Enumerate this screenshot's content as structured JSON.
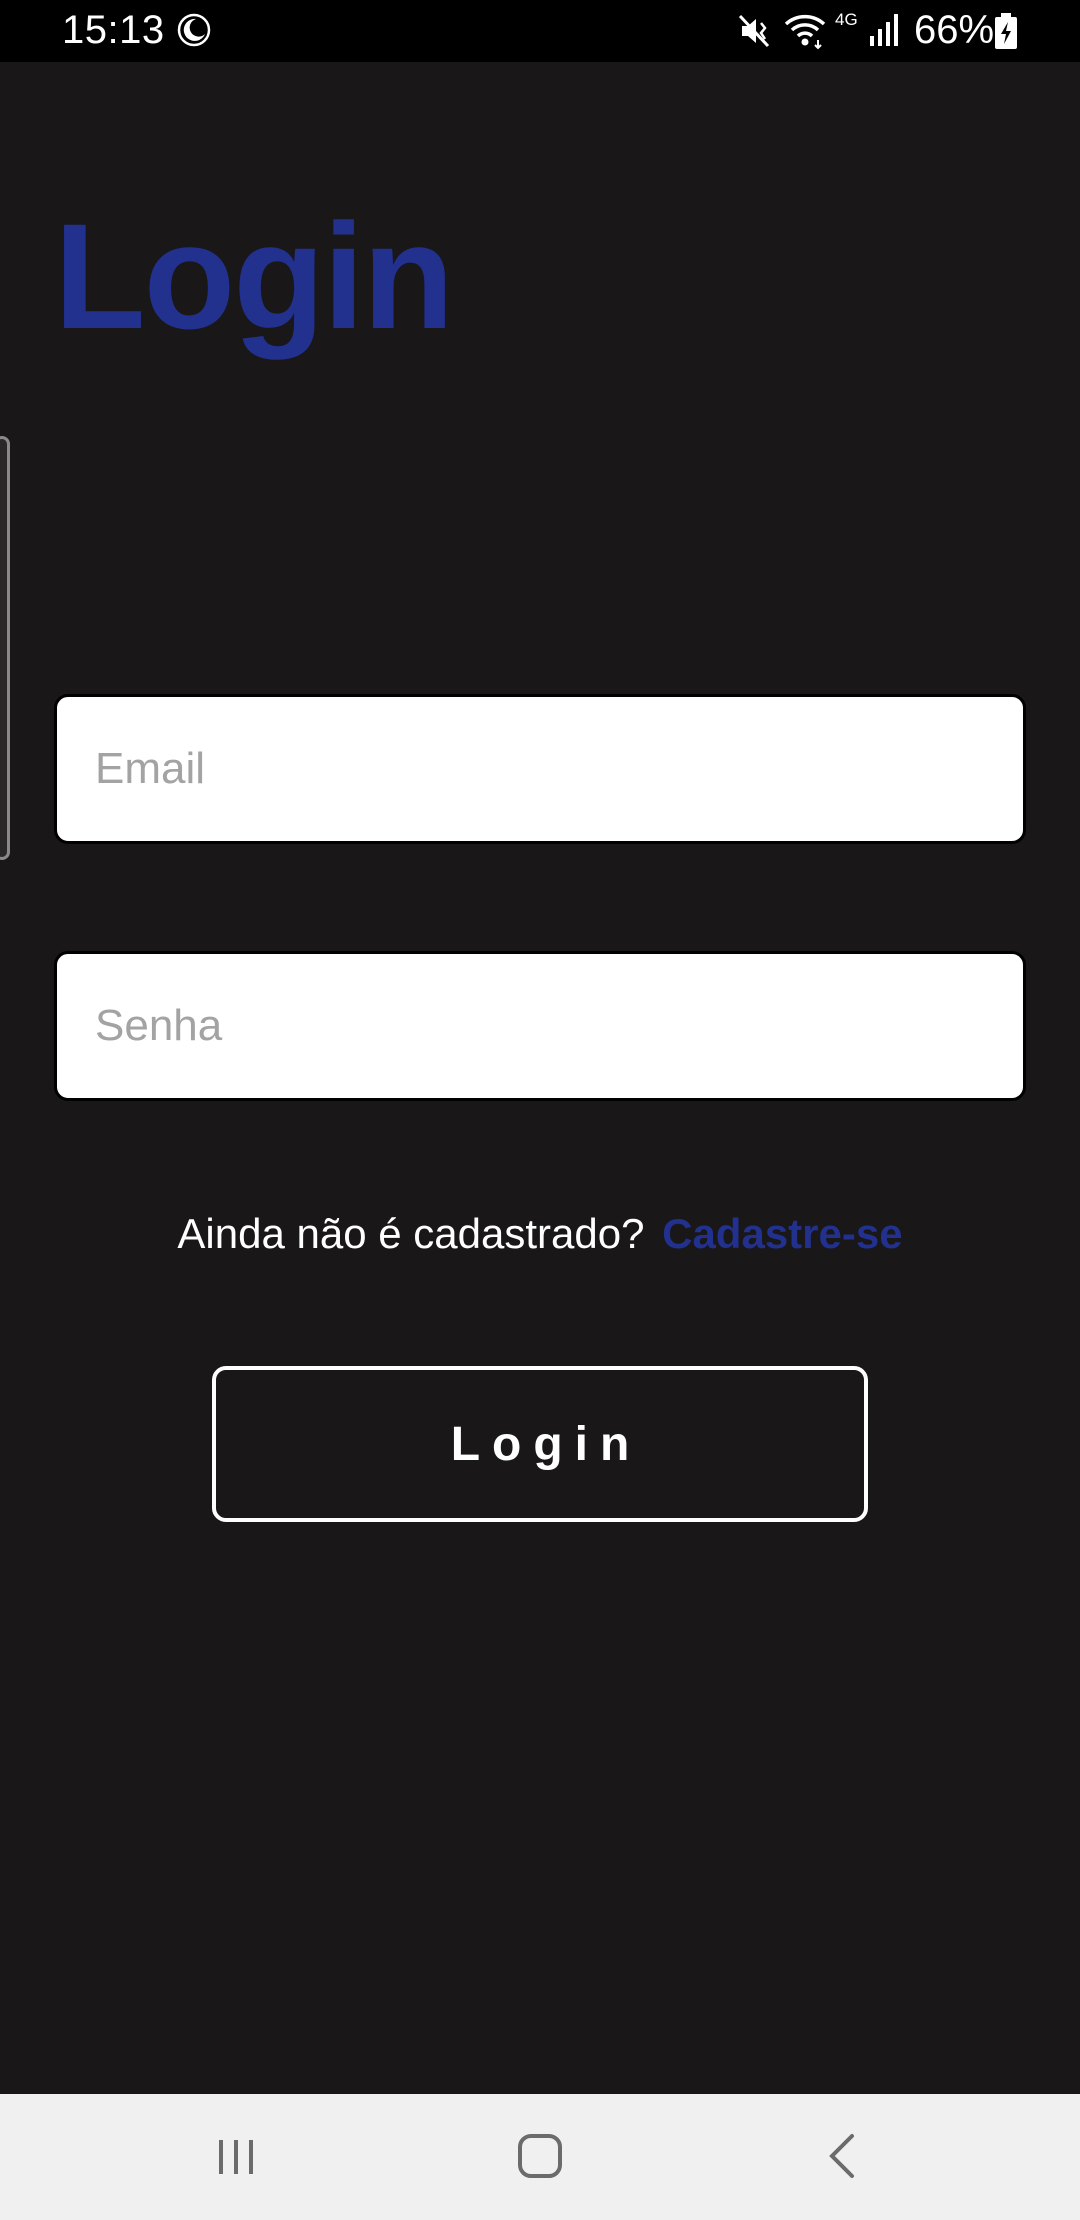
{
  "status_bar": {
    "time": "15:13",
    "network_type": "4G",
    "battery": "66%",
    "icons": [
      "moon-icon",
      "mute-icon",
      "wifi-icon",
      "signal-icon",
      "battery-icon"
    ]
  },
  "page": {
    "title": "Login"
  },
  "form": {
    "email": {
      "placeholder": "Email",
      "value": ""
    },
    "password": {
      "placeholder": "Senha",
      "value": ""
    }
  },
  "register": {
    "prompt": "Ainda não é cadastrado?",
    "link": "Cadastre-se"
  },
  "login_button": {
    "label": "Login"
  },
  "nav_bar": {
    "icons": [
      "recents-icon",
      "home-icon",
      "back-icon"
    ]
  },
  "colors": {
    "background": "#191718",
    "accent": "#22308e",
    "status_bar": "#000000",
    "nav_bar": "#f0f0f0"
  }
}
